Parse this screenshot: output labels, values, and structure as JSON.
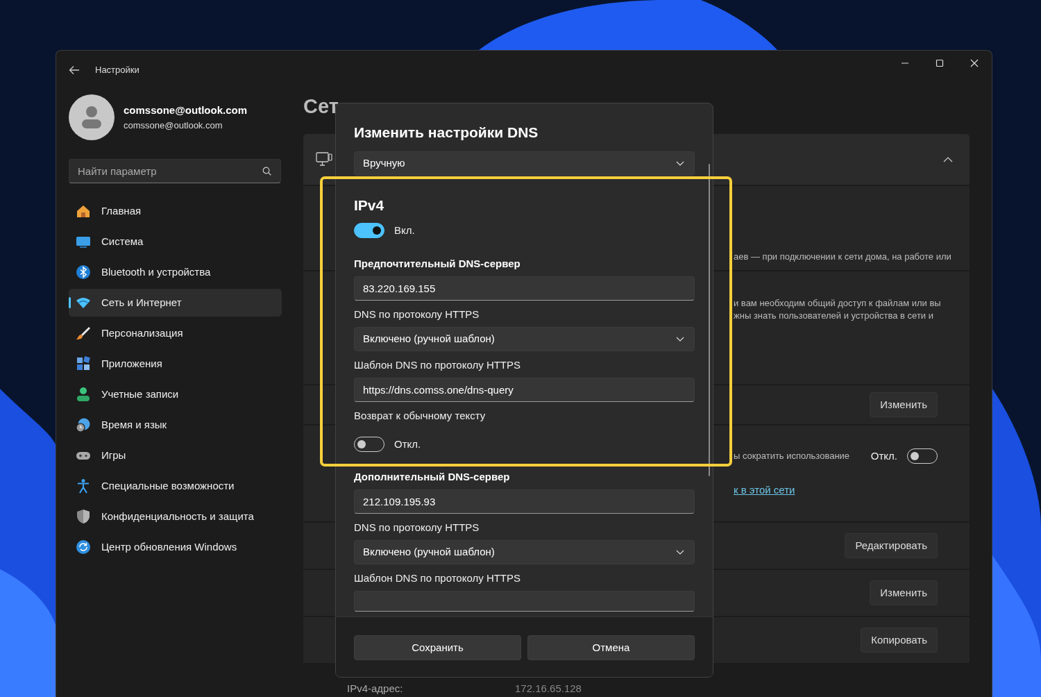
{
  "window": {
    "title": "Настройки"
  },
  "account": {
    "name": "comssone@outlook.com",
    "email": "comssone@outlook.com"
  },
  "search": {
    "placeholder": "Найти параметр"
  },
  "sidebar": {
    "items": [
      {
        "kind": "home",
        "label": "Главная",
        "selected": false
      },
      {
        "kind": "system",
        "label": "Система",
        "selected": false
      },
      {
        "kind": "bluetooth",
        "label": "Bluetooth и устройства",
        "selected": false
      },
      {
        "kind": "network",
        "label": "Сеть и Интернет",
        "selected": true
      },
      {
        "kind": "personalization",
        "label": "Персонализация",
        "selected": false
      },
      {
        "kind": "apps",
        "label": "Приложения",
        "selected": false
      },
      {
        "kind": "accounts",
        "label": "Учетные записи",
        "selected": false
      },
      {
        "kind": "time",
        "label": "Время и язык",
        "selected": false
      },
      {
        "kind": "gaming",
        "label": "Игры",
        "selected": false
      },
      {
        "kind": "accessibility",
        "label": "Специальные возможности",
        "selected": false
      },
      {
        "kind": "privacy",
        "label": "Конфиденциальность и защита",
        "selected": false
      },
      {
        "kind": "update",
        "label": "Центр обновления Windows",
        "selected": false
      }
    ]
  },
  "page": {
    "heading": "Сет",
    "rows": [
      {
        "kind": "text",
        "lines": [
          "аев — при подключении к сети дома, на работе или"
        ]
      },
      {
        "kind": "text",
        "lines": [
          "и вам необходим общий доступ к файлам или вы",
          "жны знать пользователей и устройства в сети и"
        ]
      },
      {
        "kind": "button",
        "button": "Изменить"
      },
      {
        "kind": "toggle",
        "text": "ы сократить использование",
        "state_label": "Откл.",
        "on": false,
        "link": "к в этой сети"
      },
      {
        "kind": "button",
        "button": "Редактировать"
      },
      {
        "kind": "button",
        "button": "Изменить"
      },
      {
        "kind": "button",
        "button": "Копировать"
      },
      {
        "kind": "property",
        "label": "IPv4-адрес:",
        "value": "172.16.65.128"
      }
    ]
  },
  "dialog": {
    "title": "Изменить настройки DNS",
    "mode": "Вручную",
    "items": [
      {
        "kind": "heading",
        "text": "IPv4"
      },
      {
        "kind": "toggle",
        "on": true,
        "text": "Вкл."
      },
      {
        "kind": "field_title",
        "text": "Предпочтительный DNS-сервер"
      },
      {
        "kind": "input",
        "value": "83.220.169.155"
      },
      {
        "kind": "label",
        "text": "DNS по протоколу HTTPS"
      },
      {
        "kind": "select",
        "value": "Включено (ручной шаблон)"
      },
      {
        "kind": "label",
        "text": "Шаблон DNS по протоколу HTTPS"
      },
      {
        "kind": "input",
        "value": "https://dns.comss.one/dns-query"
      },
      {
        "kind": "label",
        "text": "Возврат к обычному тексту"
      },
      {
        "kind": "toggle",
        "on": false,
        "text": "Откл."
      },
      {
        "kind": "field_title",
        "text": "Дополнительный DNS-сервер"
      },
      {
        "kind": "input",
        "value": "212.109.195.93"
      },
      {
        "kind": "label",
        "text": "DNS по протоколу HTTPS"
      },
      {
        "kind": "select",
        "value": "Включено (ручной шаблон)"
      },
      {
        "kind": "label",
        "text": "Шаблон DNS по протоколу HTTPS"
      },
      {
        "kind": "input_partial"
      }
    ],
    "buttons": [
      "Сохранить",
      "Отмена"
    ]
  }
}
